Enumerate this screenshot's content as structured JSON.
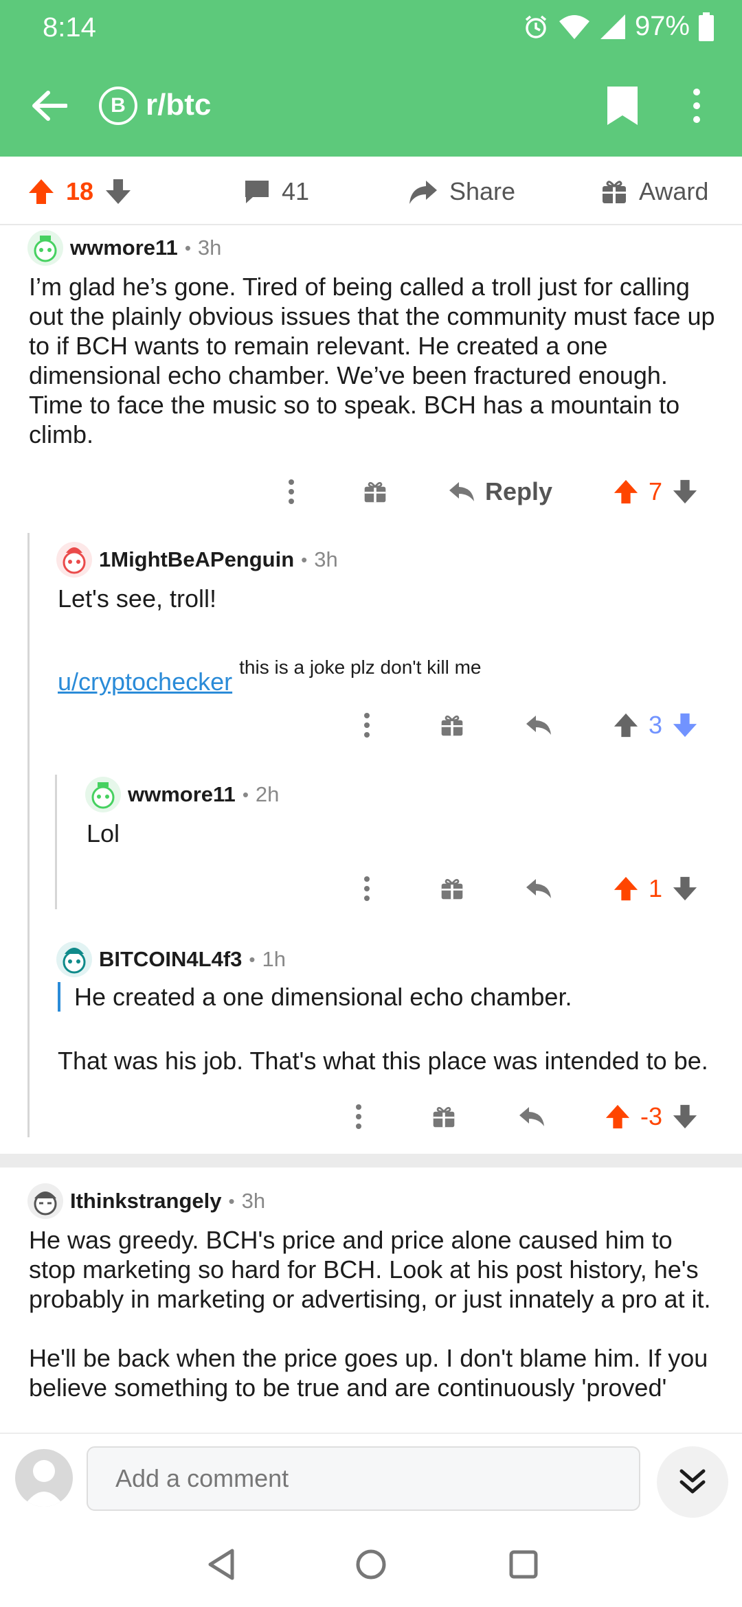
{
  "status": {
    "time": "8:14",
    "battery": "97%"
  },
  "header": {
    "subreddit": "r/btc",
    "badge": "B"
  },
  "post_actions": {
    "score": "18",
    "comments": "41",
    "share": "Share",
    "award": "Award"
  },
  "colors": {
    "brand": "#5dc97b",
    "upvote": "#ff4500",
    "downvote": "#7193ff",
    "link": "#2a8bd8"
  },
  "comments": [
    {
      "user": "wwmore11",
      "sep": "•",
      "age": "3h",
      "body": "I’m glad he’s gone. Tired of being called a troll just for calling out the plainly obvious issues that the community must face up to if BCH wants to remain relevant. He created a one dimensional echo chamber. We’ve been fractured enough. Time to face the music so to speak. BCH has a mountain to climb.",
      "reply_label": "Reply",
      "score": "7",
      "vote": "up"
    },
    {
      "user": "1MightBeAPenguin",
      "sep": "•",
      "age": "3h",
      "body_line1": "Let's see, troll!",
      "mention": "u/cryptochecker",
      "superscript": "this is a joke plz don't kill me",
      "score": "3",
      "vote": "down"
    },
    {
      "user": "wwmore11",
      "sep": "•",
      "age": "2h",
      "body": "Lol",
      "score": "1",
      "vote": "up"
    },
    {
      "user": "BITCOIN4L4f3",
      "sep": "•",
      "age": "1h",
      "quote": "He created a one dimensional echo chamber.",
      "body": "That was his job. That's what this place was intended to be.",
      "score": "-3",
      "vote": "up"
    },
    {
      "user": "Ithinkstrangely",
      "sep": "•",
      "age": "3h",
      "body1": "He was greedy. BCH's price and price alone caused him to stop marketing so hard for BCH. Look at his post history, he's probably in marketing or advertising, or just innately a pro at it.",
      "body2": "He'll be back when the price goes up. I don't blame him. If you believe something to be true and are continuously 'proved'"
    }
  ],
  "composer": {
    "placeholder": "Add a comment"
  }
}
